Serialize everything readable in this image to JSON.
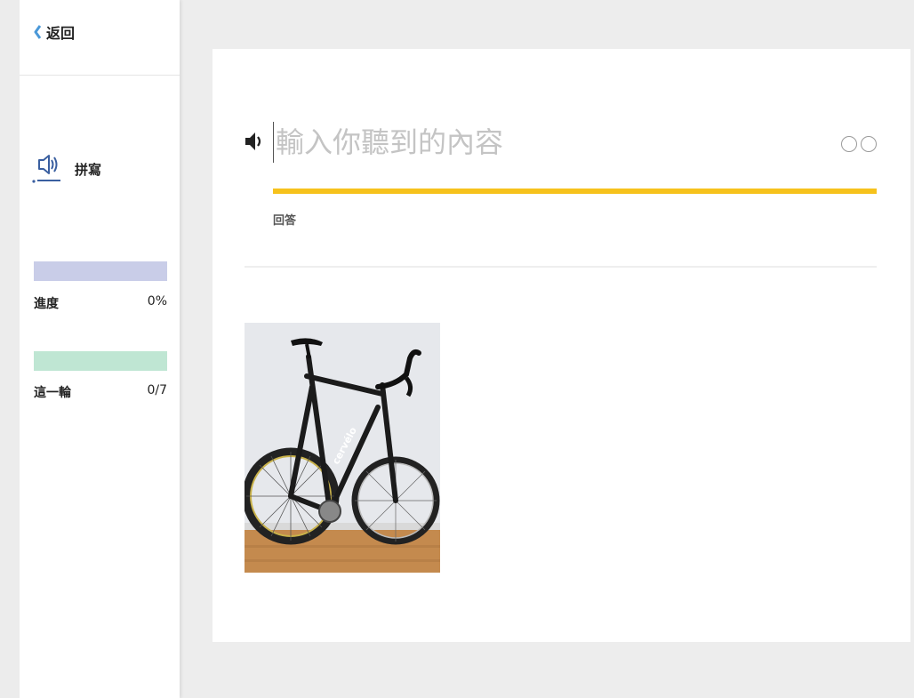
{
  "sidebar": {
    "back_label": "返回",
    "mode_label": "拼寫",
    "progress": {
      "label": "進度",
      "value_text": "0%",
      "value": 0
    },
    "round": {
      "label": "這一輪",
      "value_text": "0/7",
      "completed": 0,
      "total": 7
    }
  },
  "main": {
    "input": {
      "placeholder": "輸入你聽到的內容",
      "value": ""
    },
    "answer_label": "回答",
    "status_circles": 2,
    "picture": "bicycle"
  },
  "colors": {
    "accent_yellow": "#f6c21c",
    "progress_track": "#c9cde8",
    "round_track": "#bfe6d3",
    "back_icon": "#4a98d8",
    "mode_icon": "#3a5fa0"
  }
}
